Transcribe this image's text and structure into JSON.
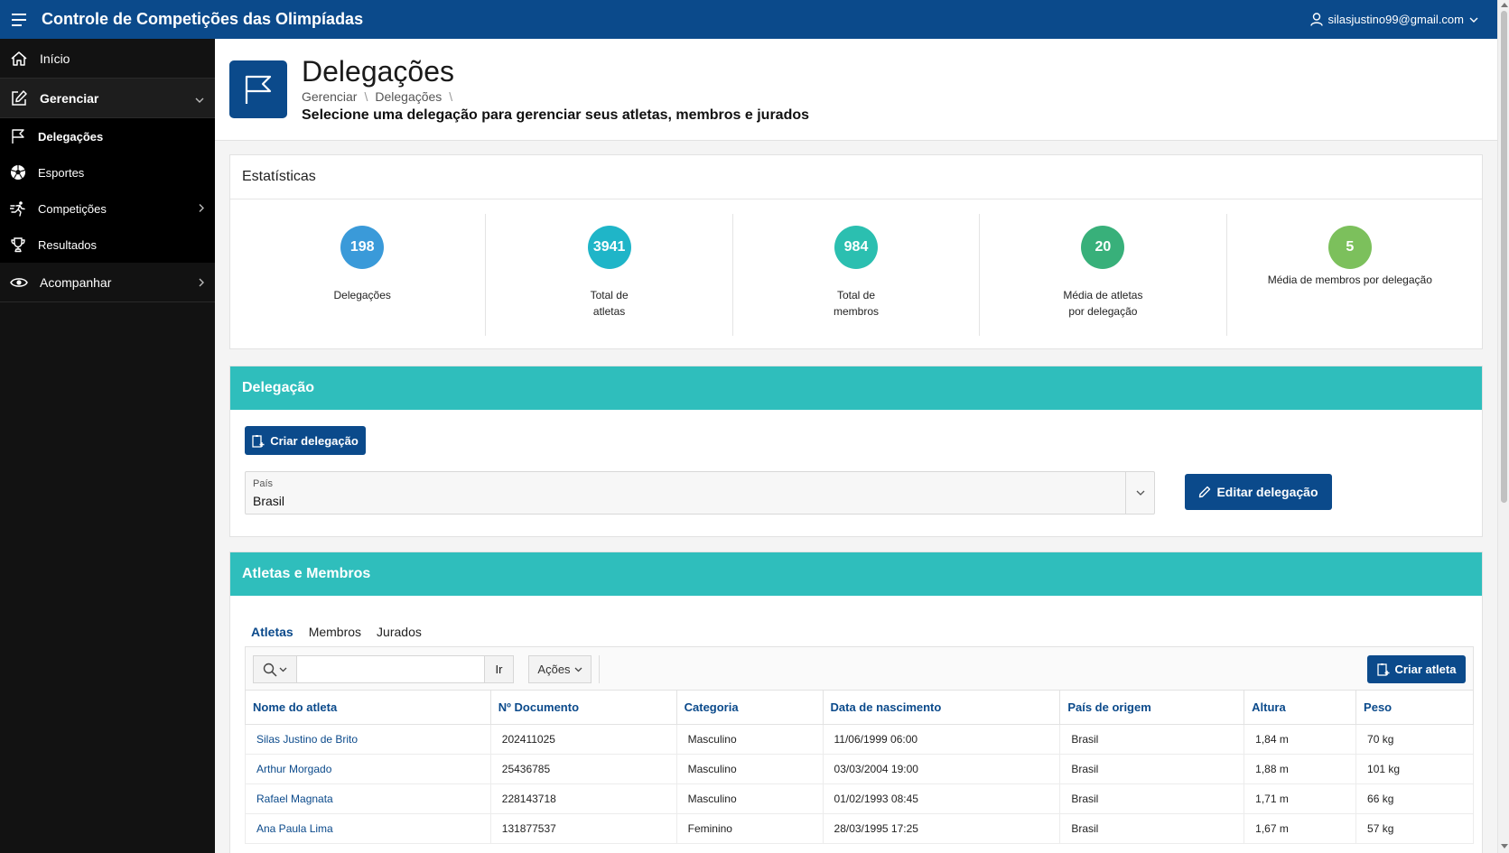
{
  "app": {
    "title": "Controle de Competições das Olimpíadas",
    "user_email": "silasjustino99@gmail.com"
  },
  "sidebar": {
    "items": [
      {
        "label": "Início",
        "icon": "home-icon"
      },
      {
        "label": "Gerenciar",
        "icon": "edit-icon",
        "expanded": true
      },
      {
        "label": "Acompanhar",
        "icon": "eye-icon"
      }
    ],
    "subitems": [
      {
        "label": "Delegações",
        "icon": "flag-icon",
        "current": true
      },
      {
        "label": "Esportes",
        "icon": "soccer-ball-icon"
      },
      {
        "label": "Competições",
        "icon": "running-icon"
      },
      {
        "label": "Resultados",
        "icon": "trophy-icon"
      }
    ]
  },
  "hero": {
    "title": "Delegações",
    "breadcrumb": [
      "Gerenciar",
      "Delegações"
    ],
    "subtitle": "Selecione uma delegação para gerenciar seus atletas, membros e jurados"
  },
  "stats": {
    "title": "Estatísticas",
    "items": [
      {
        "value": "198",
        "label": "Delegações",
        "color": "#3a9ad9"
      },
      {
        "value": "3941",
        "label": "Total de atletas",
        "color": "#1fb5c8"
      },
      {
        "value": "984",
        "label": "Total de membros",
        "color": "#2bbfb0"
      },
      {
        "value": "20",
        "label": "Média de atletas por delegação",
        "color": "#38b07a"
      },
      {
        "value": "5",
        "label": "Média de membros por delegação",
        "color": "#7cc05c"
      }
    ]
  },
  "delegacao": {
    "title": "Delegação",
    "create_label": "Criar delegação",
    "country_label": "País",
    "country_value": "Brasil",
    "edit_label": "Editar delegação"
  },
  "athletes": {
    "title": "Atletas e Membros",
    "tabs": [
      "Atletas",
      "Membros",
      "Jurados"
    ],
    "search_value": "",
    "go_label": "Ir",
    "actions_label": "Ações",
    "create_label": "Criar atleta",
    "columns": [
      "Nome do atleta",
      "Nº Documento",
      "Categoria",
      "Data de nascimento",
      "País de origem",
      "Altura",
      "Peso"
    ],
    "rows": [
      [
        "Silas Justino de Brito",
        "202411025",
        "Masculino",
        "11/06/1999 06:00",
        "Brasil",
        "1,84 m",
        "70 kg"
      ],
      [
        "Arthur Morgado",
        "25436785",
        "Masculino",
        "03/03/2004 19:00",
        "Brasil",
        "1,88 m",
        "101 kg"
      ],
      [
        "Rafael Magnata",
        "228143718",
        "Masculino",
        "01/02/1993 08:45",
        "Brasil",
        "1,71 m",
        "66 kg"
      ],
      [
        "Ana Paula Lima",
        "131877537",
        "Feminino",
        "28/03/1995 17:25",
        "Brasil",
        "1,67 m",
        "57 kg"
      ]
    ]
  },
  "colors": {
    "primary": "#0b4a8b",
    "teal": "#2fbebc",
    "sidebar": "#121212"
  }
}
